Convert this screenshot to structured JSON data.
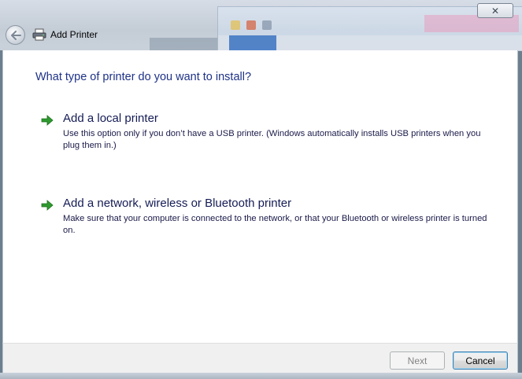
{
  "window": {
    "title": "Add Printer",
    "close_label": "✕"
  },
  "main": {
    "heading": "What type of printer do you want to install?",
    "options": [
      {
        "title": "Add a local printer",
        "description": "Use this option only if you don’t have a USB printer. (Windows automatically installs USB printers when you plug them in.)"
      },
      {
        "title": "Add a network, wireless or Bluetooth printer",
        "description": "Make sure that your computer is connected to the network, or that your Bluetooth or wireless printer is turned on."
      }
    ]
  },
  "footer": {
    "next_label": "Next",
    "cancel_label": "Cancel"
  },
  "icons": {
    "back": "back-arrow-icon",
    "printer": "printer-icon",
    "option_arrow": "green-arrow-icon"
  },
  "colors": {
    "heading": "#1e3287",
    "option_arrow": "#2e9a2e",
    "accent_border": "#3c7fb1"
  }
}
